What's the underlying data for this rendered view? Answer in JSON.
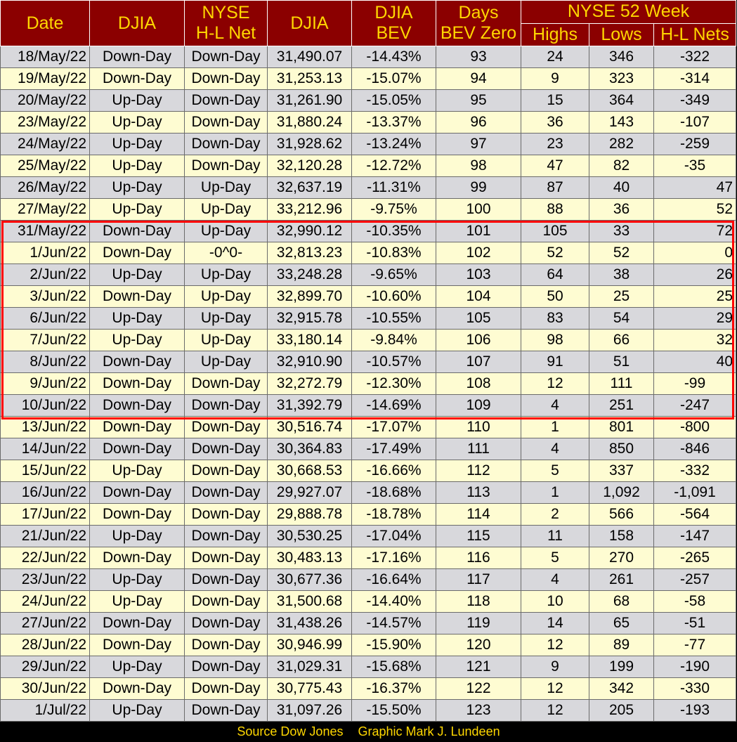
{
  "chart_data": {
    "type": "table",
    "header": {
      "date": "Date",
      "djia_dir": "DJIA",
      "nyse_hl_net_1": "NYSE",
      "nyse_hl_net_2": "H-L Net",
      "djia": "DJIA",
      "bev_1": "DJIA",
      "bev_2": "BEV",
      "days_1": "Days",
      "days_2": "BEV Zero",
      "group": "NYSE 52 Week",
      "highs": "Highs",
      "lows": "Lows",
      "nets": "H-L Nets"
    },
    "rows": [
      [
        "18/May/22",
        "Down-Day",
        "Down-Day",
        "31,490.07",
        "-14.43%",
        "93",
        "24",
        "346",
        "-322"
      ],
      [
        "19/May/22",
        "Down-Day",
        "Down-Day",
        "31,253.13",
        "-15.07%",
        "94",
        "9",
        "323",
        "-314"
      ],
      [
        "20/May/22",
        "Up-Day",
        "Down-Day",
        "31,261.90",
        "-15.05%",
        "95",
        "15",
        "364",
        "-349"
      ],
      [
        "23/May/22",
        "Up-Day",
        "Down-Day",
        "31,880.24",
        "-13.37%",
        "96",
        "36",
        "143",
        "-107"
      ],
      [
        "24/May/22",
        "Up-Day",
        "Down-Day",
        "31,928.62",
        "-13.24%",
        "97",
        "23",
        "282",
        "-259"
      ],
      [
        "25/May/22",
        "Up-Day",
        "Down-Day",
        "32,120.28",
        "-12.72%",
        "98",
        "47",
        "82",
        "-35"
      ],
      [
        "26/May/22",
        "Up-Day",
        "Up-Day",
        "32,637.19",
        "-11.31%",
        "99",
        "87",
        "40",
        "47"
      ],
      [
        "27/May/22",
        "Up-Day",
        "Up-Day",
        "33,212.96",
        "-9.75%",
        "100",
        "88",
        "36",
        "52"
      ],
      [
        "31/May/22",
        "Down-Day",
        "Up-Day",
        "32,990.12",
        "-10.35%",
        "101",
        "105",
        "33",
        "72"
      ],
      [
        "1/Jun/22",
        "Down-Day",
        "-0^0-",
        "32,813.23",
        "-10.83%",
        "102",
        "52",
        "52",
        "0"
      ],
      [
        "2/Jun/22",
        "Up-Day",
        "Up-Day",
        "33,248.28",
        "-9.65%",
        "103",
        "64",
        "38",
        "26"
      ],
      [
        "3/Jun/22",
        "Down-Day",
        "Up-Day",
        "32,899.70",
        "-10.60%",
        "104",
        "50",
        "25",
        "25"
      ],
      [
        "6/Jun/22",
        "Up-Day",
        "Up-Day",
        "32,915.78",
        "-10.55%",
        "105",
        "83",
        "54",
        "29"
      ],
      [
        "7/Jun/22",
        "Up-Day",
        "Up-Day",
        "33,180.14",
        "-9.84%",
        "106",
        "98",
        "66",
        "32"
      ],
      [
        "8/Jun/22",
        "Down-Day",
        "Up-Day",
        "32,910.90",
        "-10.57%",
        "107",
        "91",
        "51",
        "40"
      ],
      [
        "9/Jun/22",
        "Down-Day",
        "Down-Day",
        "32,272.79",
        "-12.30%",
        "108",
        "12",
        "111",
        "-99"
      ],
      [
        "10/Jun/22",
        "Down-Day",
        "Down-Day",
        "31,392.79",
        "-14.69%",
        "109",
        "4",
        "251",
        "-247"
      ],
      [
        "13/Jun/22",
        "Down-Day",
        "Down-Day",
        "30,516.74",
        "-17.07%",
        "110",
        "1",
        "801",
        "-800"
      ],
      [
        "14/Jun/22",
        "Down-Day",
        "Down-Day",
        "30,364.83",
        "-17.49%",
        "111",
        "4",
        "850",
        "-846"
      ],
      [
        "15/Jun/22",
        "Up-Day",
        "Down-Day",
        "30,668.53",
        "-16.66%",
        "112",
        "5",
        "337",
        "-332"
      ],
      [
        "16/Jun/22",
        "Down-Day",
        "Down-Day",
        "29,927.07",
        "-18.68%",
        "113",
        "1",
        "1,092",
        "-1,091"
      ],
      [
        "17/Jun/22",
        "Down-Day",
        "Down-Day",
        "29,888.78",
        "-18.78%",
        "114",
        "2",
        "566",
        "-564"
      ],
      [
        "21/Jun/22",
        "Up-Day",
        "Down-Day",
        "30,530.25",
        "-17.04%",
        "115",
        "11",
        "158",
        "-147"
      ],
      [
        "22/Jun/22",
        "Down-Day",
        "Down-Day",
        "30,483.13",
        "-17.16%",
        "116",
        "5",
        "270",
        "-265"
      ],
      [
        "23/Jun/22",
        "Up-Day",
        "Down-Day",
        "30,677.36",
        "-16.64%",
        "117",
        "4",
        "261",
        "-257"
      ],
      [
        "24/Jun/22",
        "Up-Day",
        "Down-Day",
        "31,500.68",
        "-14.40%",
        "118",
        "10",
        "68",
        "-58"
      ],
      [
        "27/Jun/22",
        "Down-Day",
        "Down-Day",
        "31,438.26",
        "-14.57%",
        "119",
        "14",
        "65",
        "-51"
      ],
      [
        "28/Jun/22",
        "Down-Day",
        "Down-Day",
        "30,946.99",
        "-15.90%",
        "120",
        "12",
        "89",
        "-77"
      ],
      [
        "29/Jun/22",
        "Up-Day",
        "Down-Day",
        "31,029.31",
        "-15.68%",
        "121",
        "9",
        "199",
        "-190"
      ],
      [
        "30/Jun/22",
        "Down-Day",
        "Down-Day",
        "30,775.43",
        "-16.37%",
        "122",
        "12",
        "342",
        "-330"
      ],
      [
        "1/Jul/22",
        "Up-Day",
        "Down-Day",
        "31,097.26",
        "-15.50%",
        "123",
        "12",
        "205",
        "-193"
      ]
    ],
    "highlight_rows": [
      "26/May/22",
      "8/Jun/22"
    ]
  },
  "footer": {
    "source": "Source Dow Jones",
    "graphic": "Graphic Mark J. Lundeen"
  },
  "colors": {
    "header_bg": "#8b0000",
    "header_text": "#ffd700",
    "row_odd": "#d8d8dc",
    "row_even": "#fefcd2",
    "highlight_border": "#ff0000",
    "footer_text": "#ffd700"
  }
}
